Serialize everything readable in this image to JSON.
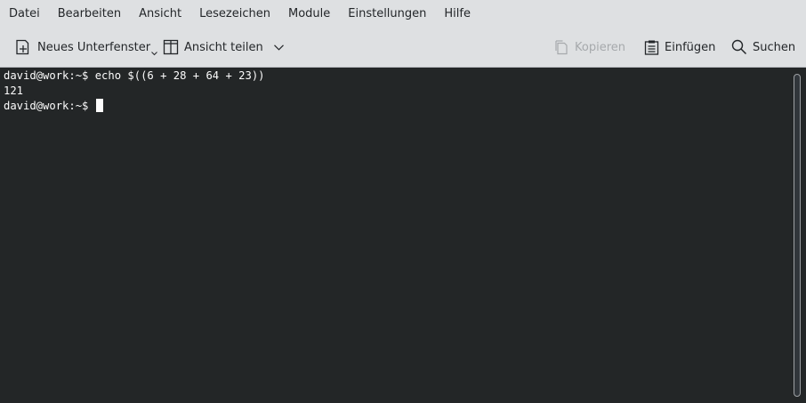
{
  "menubar": {
    "items": [
      "Datei",
      "Bearbeiten",
      "Ansicht",
      "Lesezeichen",
      "Module",
      "Einstellungen",
      "Hilfe"
    ]
  },
  "toolbar": {
    "new_tab_label": "Neues Unterfenster",
    "split_view_label": "Ansicht teilen",
    "copy_label": "Kopieren",
    "paste_label": "Einfügen",
    "search_label": "Suchen"
  },
  "terminal": {
    "lines": [
      "david@work:~$ echo $((6 + 28 + 64 + 23))",
      "121",
      "david@work:~$ "
    ]
  },
  "colors": {
    "chrome_bg": "#dee0e2",
    "terminal_bg": "#232627",
    "terminal_fg": "#fcfcfc"
  }
}
